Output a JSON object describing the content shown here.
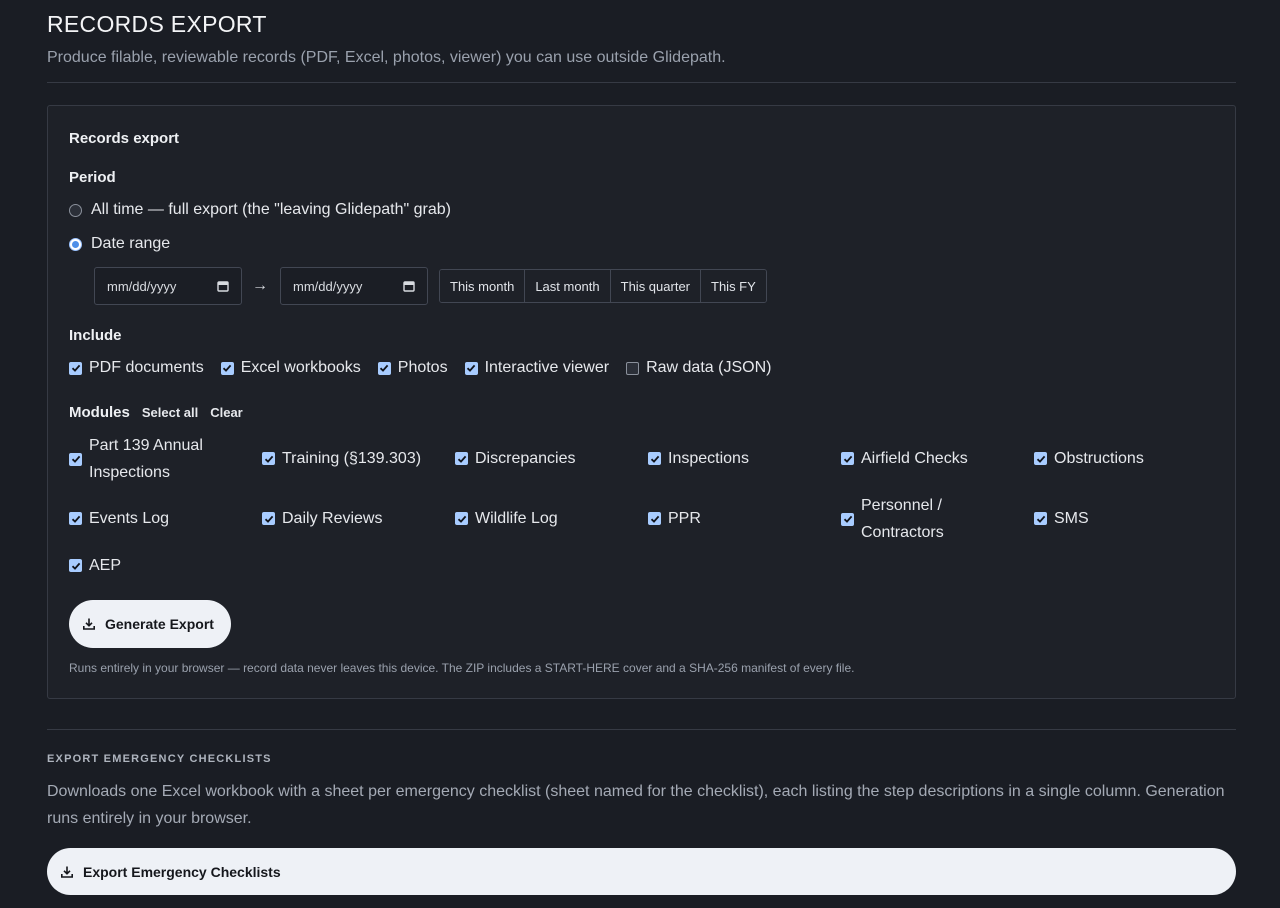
{
  "page": {
    "title": "RECORDS EXPORT",
    "subtitle": "Produce filable, reviewable records (PDF, Excel, photos, viewer) you can use outside Glidepath."
  },
  "records_export": {
    "card_title": "Records export",
    "period": {
      "label": "Period",
      "options": [
        {
          "label": "All time — full export (the \"leaving Glidepath\" grab)",
          "checked": false
        },
        {
          "label": "Date range",
          "checked": true
        }
      ],
      "from_placeholder": "mm/dd/yyyy",
      "to_placeholder": "mm/dd/yyyy",
      "arrow": "→",
      "presets": [
        "This month",
        "Last month",
        "This quarter",
        "This FY"
      ]
    },
    "include": {
      "label": "Include",
      "items": [
        {
          "label": "PDF documents",
          "checked": true
        },
        {
          "label": "Excel workbooks",
          "checked": true
        },
        {
          "label": "Photos",
          "checked": true
        },
        {
          "label": "Interactive viewer",
          "checked": true
        },
        {
          "label": "Raw data (JSON)",
          "checked": false
        }
      ]
    },
    "modules": {
      "label": "Modules",
      "select_all": "Select all",
      "clear": "Clear",
      "items": [
        {
          "label": "Part 139 Annual Inspections",
          "checked": true
        },
        {
          "label": "Training (§139.303)",
          "checked": true
        },
        {
          "label": "Discrepancies",
          "checked": true
        },
        {
          "label": "Inspections",
          "checked": true
        },
        {
          "label": "Airfield Checks",
          "checked": true
        },
        {
          "label": "Obstructions",
          "checked": true
        },
        {
          "label": "Events Log",
          "checked": true
        },
        {
          "label": "Daily Reviews",
          "checked": true
        },
        {
          "label": "Wildlife Log",
          "checked": true
        },
        {
          "label": "PPR",
          "checked": true
        },
        {
          "label": "Personnel / Contractors",
          "checked": true
        },
        {
          "label": "SMS",
          "checked": true
        },
        {
          "label": "AEP",
          "checked": true
        }
      ]
    },
    "generate_label": "Generate Export",
    "footnote": "Runs entirely in your browser — record data never leaves this device. The ZIP includes a START-HERE cover and a SHA-256 manifest of every file."
  },
  "emergency": {
    "label": "EXPORT EMERGENCY CHECKLISTS",
    "description": "Downloads one Excel workbook with a sheet per emergency checklist (sheet named for the checklist), each listing the step descriptions in a single column. Generation runs entirely in your browser.",
    "button_label": "Export Emergency Checklists"
  },
  "colors": {
    "background": "#1a1d24",
    "card": "#1e2128",
    "checkbox_on": "#a8ccff",
    "button": "#eef1f6"
  }
}
